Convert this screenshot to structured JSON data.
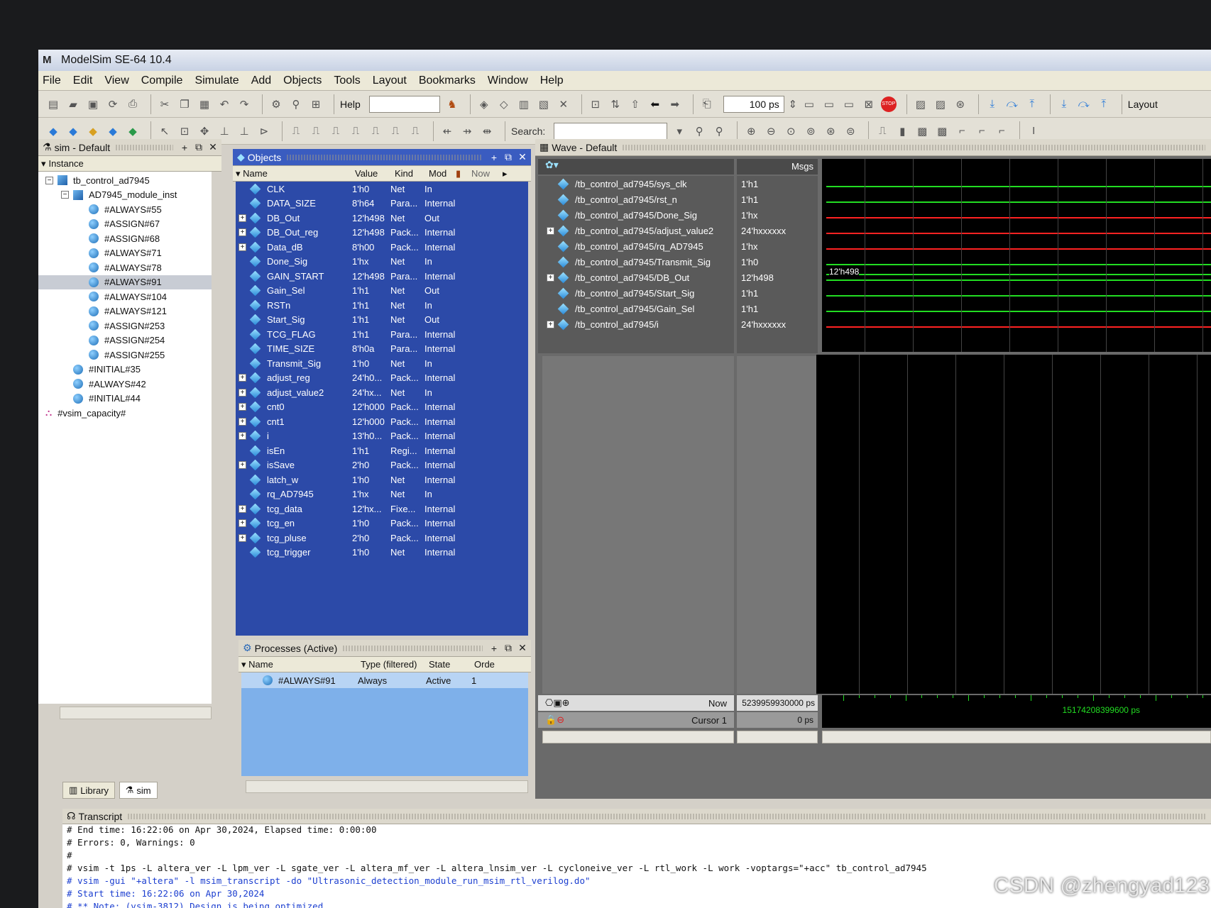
{
  "window": {
    "title": "ModelSim SE-64 10.4",
    "logo": "M"
  },
  "menu": [
    "File",
    "Edit",
    "View",
    "Compile",
    "Simulate",
    "Add",
    "Objects",
    "Tools",
    "Layout",
    "Bookmarks",
    "Window",
    "Help"
  ],
  "toolbar": {
    "help_label": "Help",
    "run_length": "100 ps",
    "search_label": "Search:",
    "layout_label": "Layout"
  },
  "sim_panel": {
    "title": "sim - Default",
    "column": "Instance",
    "items": [
      {
        "label": "tb_control_ad7945",
        "indent": 0,
        "icon": "cube"
      },
      {
        "label": "AD7945_module_inst",
        "indent": 1,
        "icon": "cube"
      },
      {
        "label": "#ALWAYS#55",
        "indent": 2,
        "icon": "ball"
      },
      {
        "label": "#ASSIGN#67",
        "indent": 2,
        "icon": "ball"
      },
      {
        "label": "#ASSIGN#68",
        "indent": 2,
        "icon": "ball"
      },
      {
        "label": "#ALWAYS#71",
        "indent": 2,
        "icon": "ball"
      },
      {
        "label": "#ALWAYS#78",
        "indent": 2,
        "icon": "ball"
      },
      {
        "label": "#ALWAYS#91",
        "indent": 2,
        "icon": "ball",
        "selected": true
      },
      {
        "label": "#ALWAYS#104",
        "indent": 2,
        "icon": "ball"
      },
      {
        "label": "#ALWAYS#121",
        "indent": 2,
        "icon": "ball"
      },
      {
        "label": "#ASSIGN#253",
        "indent": 2,
        "icon": "ball"
      },
      {
        "label": "#ASSIGN#254",
        "indent": 2,
        "icon": "ball"
      },
      {
        "label": "#ASSIGN#255",
        "indent": 2,
        "icon": "ball"
      },
      {
        "label": "#INITIAL#35",
        "indent": 1,
        "icon": "ball"
      },
      {
        "label": "#ALWAYS#42",
        "indent": 1,
        "icon": "ball"
      },
      {
        "label": "#INITIAL#44",
        "indent": 1,
        "icon": "ball"
      },
      {
        "label": "#vsim_capacity#",
        "indent": 0,
        "icon": "chart"
      }
    ],
    "tabs": [
      "Library",
      "sim"
    ]
  },
  "objects_panel": {
    "title": "Objects",
    "columns": {
      "name": "Name",
      "value": "Value",
      "kind": "Kind",
      "mode": "Mod",
      "now": "Now"
    },
    "rows": [
      {
        "name": "CLK",
        "value": "1'h0",
        "kind": "Net",
        "mode": "In",
        "expand": false
      },
      {
        "name": "DATA_SIZE",
        "value": "8'h64",
        "kind": "Para...",
        "mode": "Internal",
        "expand": false
      },
      {
        "name": "DB_Out",
        "value": "12'h498",
        "kind": "Net",
        "mode": "Out",
        "expand": true
      },
      {
        "name": "DB_Out_reg",
        "value": "12'h498",
        "kind": "Pack...",
        "mode": "Internal",
        "expand": true
      },
      {
        "name": "Data_dB",
        "value": "8'h00",
        "kind": "Pack...",
        "mode": "Internal",
        "expand": true
      },
      {
        "name": "Done_Sig",
        "value": "1'hx",
        "kind": "Net",
        "mode": "In",
        "expand": false
      },
      {
        "name": "GAIN_START",
        "value": "12'h498",
        "kind": "Para...",
        "mode": "Internal",
        "expand": false
      },
      {
        "name": "Gain_Sel",
        "value": "1'h1",
        "kind": "Net",
        "mode": "Out",
        "expand": false
      },
      {
        "name": "RSTn",
        "value": "1'h1",
        "kind": "Net",
        "mode": "In",
        "expand": false
      },
      {
        "name": "Start_Sig",
        "value": "1'h1",
        "kind": "Net",
        "mode": "Out",
        "expand": false
      },
      {
        "name": "TCG_FLAG",
        "value": "1'h1",
        "kind": "Para...",
        "mode": "Internal",
        "expand": false
      },
      {
        "name": "TIME_SIZE",
        "value": "8'h0a",
        "kind": "Para...",
        "mode": "Internal",
        "expand": false
      },
      {
        "name": "Transmit_Sig",
        "value": "1'h0",
        "kind": "Net",
        "mode": "In",
        "expand": false
      },
      {
        "name": "adjust_reg",
        "value": "24'h0...",
        "kind": "Pack...",
        "mode": "Internal",
        "expand": true
      },
      {
        "name": "adjust_value2",
        "value": "24'hx...",
        "kind": "Net",
        "mode": "In",
        "expand": true
      },
      {
        "name": "cnt0",
        "value": "12'h000",
        "kind": "Pack...",
        "mode": "Internal",
        "expand": true
      },
      {
        "name": "cnt1",
        "value": "12'h000",
        "kind": "Pack...",
        "mode": "Internal",
        "expand": true
      },
      {
        "name": "i",
        "value": "13'h0...",
        "kind": "Pack...",
        "mode": "Internal",
        "expand": true
      },
      {
        "name": "isEn",
        "value": "1'h1",
        "kind": "Regi...",
        "mode": "Internal",
        "expand": false
      },
      {
        "name": "isSave",
        "value": "2'h0",
        "kind": "Pack...",
        "mode": "Internal",
        "expand": true
      },
      {
        "name": "latch_w",
        "value": "1'h0",
        "kind": "Net",
        "mode": "Internal",
        "expand": false
      },
      {
        "name": "rq_AD7945",
        "value": "1'hx",
        "kind": "Net",
        "mode": "In",
        "expand": false
      },
      {
        "name": "tcg_data",
        "value": "12'hx...",
        "kind": "Fixe...",
        "mode": "Internal",
        "expand": true
      },
      {
        "name": "tcg_en",
        "value": "1'h0",
        "kind": "Pack...",
        "mode": "Internal",
        "expand": true
      },
      {
        "name": "tcg_pluse",
        "value": "2'h0",
        "kind": "Pack...",
        "mode": "Internal",
        "expand": true
      },
      {
        "name": "tcg_trigger",
        "value": "1'h0",
        "kind": "Net",
        "mode": "Internal",
        "expand": false
      }
    ]
  },
  "processes_panel": {
    "title": "Processes (Active)",
    "columns": [
      "Name",
      "Type (filtered)",
      "State",
      "Orde"
    ],
    "rows": [
      {
        "name": "#ALWAYS#91",
        "type": "Always",
        "state": "Active",
        "order": "1"
      }
    ]
  },
  "wave_panel": {
    "title": "Wave - Default",
    "msgs_label": "Msgs",
    "signals": [
      {
        "path": "/tb_control_ad7945/sys_clk",
        "value": "1'h1",
        "expand": false,
        "color": "#22dd22"
      },
      {
        "path": "/tb_control_ad7945/rst_n",
        "value": "1'h1",
        "expand": false,
        "color": "#22dd22"
      },
      {
        "path": "/tb_control_ad7945/Done_Sig",
        "value": "1'hx",
        "expand": false,
        "color": "#ff2222"
      },
      {
        "path": "/tb_control_ad7945/adjust_value2",
        "value": "24'hxxxxxx",
        "expand": true,
        "color": "#ff2222"
      },
      {
        "path": "/tb_control_ad7945/rq_AD7945",
        "value": "1'hx",
        "expand": false,
        "color": "#ff2222"
      },
      {
        "path": "/tb_control_ad7945/Transmit_Sig",
        "value": "1'h0",
        "expand": false,
        "color": "#22dd22"
      },
      {
        "path": "/tb_control_ad7945/DB_Out",
        "value": "12'h498",
        "expand": true,
        "color": "#22dd22",
        "bus_label": "12'h498"
      },
      {
        "path": "/tb_control_ad7945/Start_Sig",
        "value": "1'h1",
        "expand": false,
        "color": "#22dd22"
      },
      {
        "path": "/tb_control_ad7945/Gain_Sel",
        "value": "1'h1",
        "expand": false,
        "color": "#22dd22"
      },
      {
        "path": "/tb_control_ad7945/i",
        "value": "24'hxxxxxx",
        "expand": true,
        "color": "#ff2222"
      }
    ],
    "now_label": "Now",
    "now_value": "5239959930000 ps",
    "cursor_label": "Cursor 1",
    "cursor_value": "0 ps",
    "timeline_label": "15174208399600 ps"
  },
  "transcript": {
    "title": "Transcript",
    "lines": [
      {
        "text": "# End time: 16:22:06 on Apr 30,2024, Elapsed time: 0:00:00",
        "blue": false
      },
      {
        "text": "# Errors: 0, Warnings: 0",
        "blue": false
      },
      {
        "text": "#",
        "blue": false
      },
      {
        "text": "# vsim -t 1ps -L altera_ver -L lpm_ver -L sgate_ver -L altera_mf_ver -L altera_lnsim_ver -L cycloneive_ver -L rtl_work -L work -voptargs=\"+acc\"  tb_control_ad7945",
        "blue": false
      },
      {
        "text": "# vsim -gui \"+altera\" -l msim_transcript -do \"Ultrasonic_detection_module_run_msim_rtl_verilog.do\"",
        "blue": true
      },
      {
        "text": "# Start time: 16:22:06 on Apr 30,2024",
        "blue": true
      },
      {
        "text": "# ** Note: (vsim-3812) Design is being optimized...",
        "blue": true
      }
    ]
  },
  "watermark": "CSDN @zhengyad123"
}
